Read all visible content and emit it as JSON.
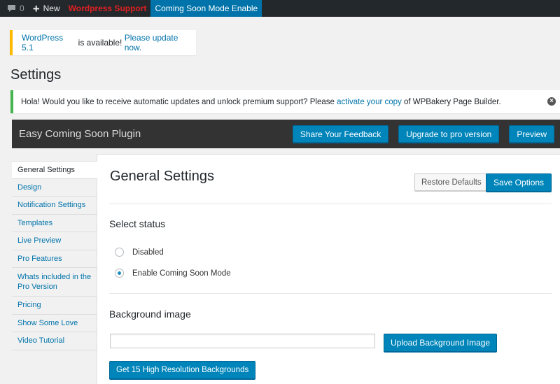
{
  "adminbar": {
    "comments_count": "0",
    "new_label": "New",
    "support_label": "Wordpress Support",
    "coming_soon_label": "Coming Soon Mode Enable"
  },
  "update_nag": {
    "version_link": "WordPress 5.1",
    "middle_text": " is available! ",
    "update_link": "Please update now."
  },
  "page_title": "Settings",
  "notice": {
    "text_before": "Hola! Would you like to receive automatic updates and unlock premium support? Please ",
    "link": "activate your copy",
    "text_after": " of WPBakery Page Builder."
  },
  "plugin_header": {
    "title": "Easy Coming Soon Plugin",
    "feedback_button": "Share Your Feedback",
    "upgrade_button": "Upgrade to pro version",
    "preview_button": "Preview"
  },
  "sidebar": {
    "items": [
      "General Settings",
      "Design",
      "Notification Settings",
      "Templates",
      "Live Preview",
      "Pro Features",
      "Whats included in the Pro Version",
      "Pricing",
      "Show Some Love",
      "Video Tutorial"
    ]
  },
  "main": {
    "title": "General Settings",
    "restore_button": "Restore Defaults",
    "save_button": "Save Options",
    "status_label": "Select status",
    "status_options": [
      "Disabled",
      "Enable Coming Soon Mode"
    ],
    "selected_status": "Enable Coming Soon Mode",
    "background_label": "Background image",
    "background_value": "",
    "upload_button": "Upload Background Image",
    "get_backgrounds_button": "Get 15 High Resolution Backgrounds"
  },
  "colors": {
    "admin_bar": "#23282d",
    "accent": "#0073aa",
    "primary_button": "#0085ba",
    "support_red": "#e02020",
    "update_nag_border": "#ffb900",
    "notice_border": "#46b450",
    "plugin_header": "#333333"
  }
}
